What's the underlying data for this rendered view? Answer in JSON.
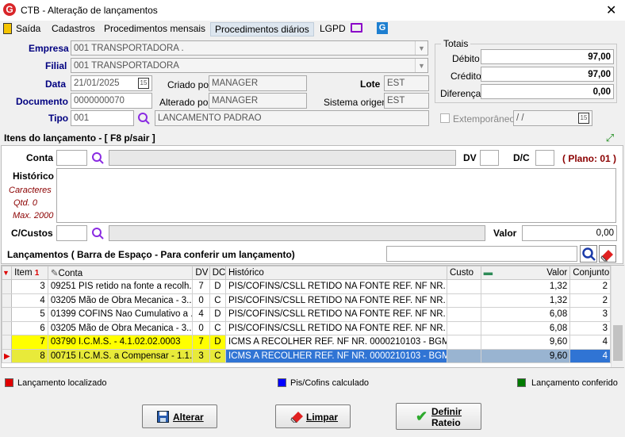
{
  "window": {
    "title": "CTB - Alteração de lançamentos",
    "logo_letter": "G",
    "close_glyph": "✕"
  },
  "menu": [
    "Saída",
    "Cadastros",
    "Procedimentos mensais",
    "Procedimentos diários",
    "LGPD"
  ],
  "header": {
    "empresa_label": "Empresa",
    "empresa_value": "001 TRANSPORTADORA .",
    "filial_label": "Filial",
    "filial_value": "001 TRANSPORTADORA",
    "data_label": "Data",
    "data_value": "21/01/2025",
    "criado_label": "Criado por",
    "criado_value": "MANAGER",
    "lote_label": "Lote",
    "lote_value": "EST",
    "documento_label": "Documento",
    "documento_value": "0000000070",
    "alterado_label": "Alterado por",
    "alterado_value": "MANAGER",
    "sistema_label": "Sistema origem",
    "sistema_value": "EST",
    "tipo_label": "Tipo",
    "tipo_value": "001",
    "tipo_desc": "LANCAMENTO PADRAO",
    "extemporaneo_label": "Extemporâneo",
    "extemporaneo_date": " /  /"
  },
  "totais": {
    "title": "Totais",
    "debito_label": "Débito",
    "debito_value": "97,00",
    "credito_label": "Crédito",
    "credito_value": "97,00",
    "diferenca_label": "Diferença",
    "diferenca_value": "0,00"
  },
  "itens": {
    "title": "Itens do lançamento - [ F8 p/sair ]",
    "conta_label": "Conta",
    "dv_label": "DV",
    "dc_label": "D/C",
    "plano_text": "( Plano: 01 )",
    "historico_label": "Histórico",
    "caracteres_label": "Caracteres",
    "qtd_label": "Qtd. 0",
    "max_label": "Max. 2000",
    "ccustos_label": "C/Custos",
    "valor_label": "Valor",
    "valor_value": "0,00"
  },
  "lancamentos": {
    "title": "Lançamentos ( Barra de Espaço - Para conferir um lançamento)",
    "columns": [
      "Item",
      "Conta",
      "DV",
      "DC",
      "Histórico",
      "Custo",
      "Valor",
      "Conjunto"
    ],
    "sort_indicator": "1",
    "rows": [
      {
        "item": "3",
        "conta": "09251 PIS retido na fonte a recolh...",
        "dv": "7",
        "dc": "D",
        "historico": "PIS/COFINS/CSLL RETIDO NA FONTE REF. NF NR. ...",
        "custo": "",
        "valor": "1,32",
        "conjunto": "2"
      },
      {
        "item": "4",
        "conta": "03205 Mão de Obra Mecanica - 3....",
        "dv": "0",
        "dc": "C",
        "historico": "PIS/COFINS/CSLL RETIDO NA FONTE REF. NF NR. ...",
        "custo": "",
        "valor": "1,32",
        "conjunto": "2"
      },
      {
        "item": "5",
        "conta": "01399 COFINS Nao Cumulativo a ...",
        "dv": "4",
        "dc": "D",
        "historico": "PIS/COFINS/CSLL RETIDO NA FONTE REF. NF NR. ...",
        "custo": "",
        "valor": "6,08",
        "conjunto": "3"
      },
      {
        "item": "6",
        "conta": "03205 Mão de Obra Mecanica - 3....",
        "dv": "0",
        "dc": "C",
        "historico": "PIS/COFINS/CSLL RETIDO NA FONTE REF. NF NR. ...",
        "custo": "",
        "valor": "6,08",
        "conjunto": "3"
      },
      {
        "item": "7",
        "conta": "03790 I.C.M.S. - 4.1.02.02.0003",
        "dv": "7",
        "dc": "D",
        "historico": "ICMS A RECOLHER REF. NF NR. 0000210103 - BGM ...",
        "custo": "",
        "valor": "9,60",
        "conjunto": "4"
      },
      {
        "item": "8",
        "conta": "00715 I.C.M.S. a Compensar - 1.1....",
        "dv": "3",
        "dc": "C",
        "historico": "ICMS A RECOLHER REF. NF NR. 0000210103 - BGM ...",
        "custo": "",
        "valor": "9,60",
        "conjunto": "4"
      }
    ]
  },
  "legend": {
    "localizado": "Lançamento localizado",
    "piscofins": "Pis/Cofins calculado",
    "conferido": "Lançamento conferido"
  },
  "buttons": {
    "alterar": "Alterar",
    "limpar": "Limpar",
    "definir1": "Definir",
    "definir2": "Rateio"
  },
  "colors": {
    "accent_red": "#d9262a",
    "legend_red": "#e00000",
    "legend_blue": "#0000ff",
    "legend_green": "#007a00",
    "highlight_yellow": "#ffff00",
    "selection_blue": "#3074d4",
    "label_blue": "#000080",
    "plano_red": "#8b0000"
  }
}
